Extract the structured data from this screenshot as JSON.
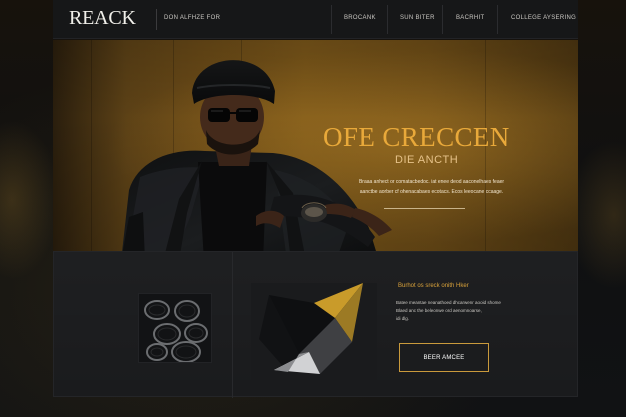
{
  "brand": {
    "logo_text": "REACK"
  },
  "nav": {
    "intro_link": "DON ALFHZE FOR",
    "links": [
      "BROCANK",
      "SUN BITER",
      "BACRHIT",
      "COLLEGE AYSERING"
    ]
  },
  "hero": {
    "title": "OFE CRECCEN",
    "subtitle": "DIE ANCTH",
    "description_lines": [
      "Braaa anhect or comatacbedoc.  iat enee deod aaconelhaes feaer",
      "aanctbe aorber cf ohenacabaes ecotacs.  Ecos leeocane ccaage."
    ]
  },
  "feature": {
    "title": "Burhot os sreck onith Hker",
    "text_lines": [
      "Batee meantae neanathoed dhcarwenr aooid shome",
      "Blaed anc the beleonwe ord aenomnoarse,",
      "idi dlg."
    ],
    "button_label": "BEER AMCEE"
  },
  "colors": {
    "accent": "#d9a13a",
    "header_bg": "#161718",
    "panel_bg": "#1a1b1d"
  }
}
